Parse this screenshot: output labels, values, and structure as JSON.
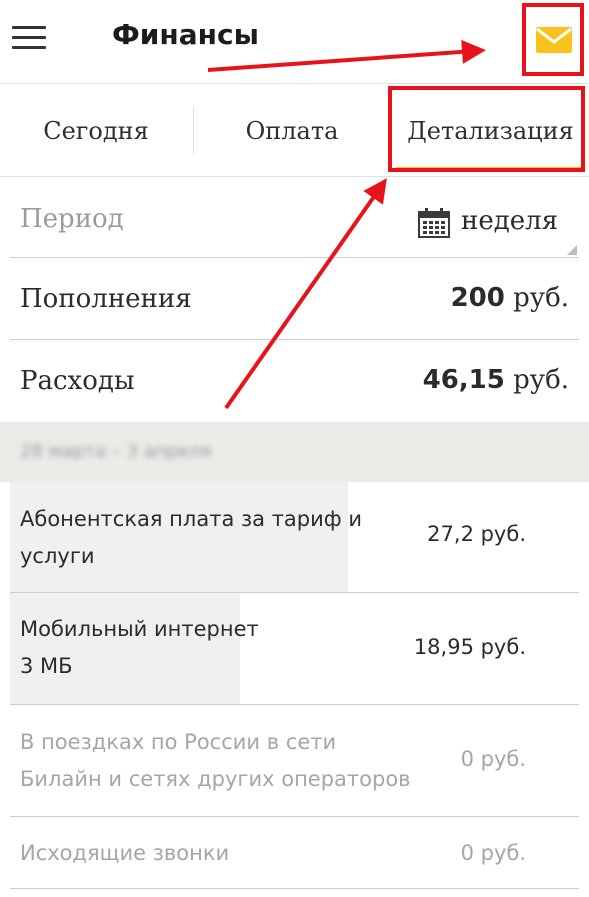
{
  "header": {
    "title": "Финансы",
    "menu_icon": "hamburger-menu-icon",
    "mail_icon": "envelope-icon",
    "mail_color": "#f9c21c"
  },
  "tabs": [
    {
      "label": "Сегодня",
      "active": false
    },
    {
      "label": "Оплата",
      "active": false
    },
    {
      "label": "Детализация",
      "active": true
    }
  ],
  "colors": {
    "accent": "#fcbf0a",
    "annotation": "#e8131a",
    "band": "#edebe8"
  },
  "period": {
    "label": "Период",
    "value": "неделя",
    "icon": "calendar-icon"
  },
  "summary": {
    "topups_label": "Пополнения",
    "topups_amount": "200",
    "expenses_label": "Расходы",
    "expenses_amount": "46,15",
    "currency": "руб."
  },
  "date_range": "28 марта – 3 апреля",
  "items": [
    {
      "line1": "Абонентская плата за тариф и",
      "line2": "услуги",
      "amount": "27,2 руб."
    },
    {
      "line1": "Мобильный интернет",
      "line2": "3 МБ",
      "amount": "18,95 руб."
    },
    {
      "line1": "В поездках по России в сети",
      "line2": "Билайн и сетях других операторов",
      "amount": "0 руб."
    },
    {
      "line1": "Исходящие звонки",
      "line2": "",
      "amount": "0 руб."
    }
  ]
}
